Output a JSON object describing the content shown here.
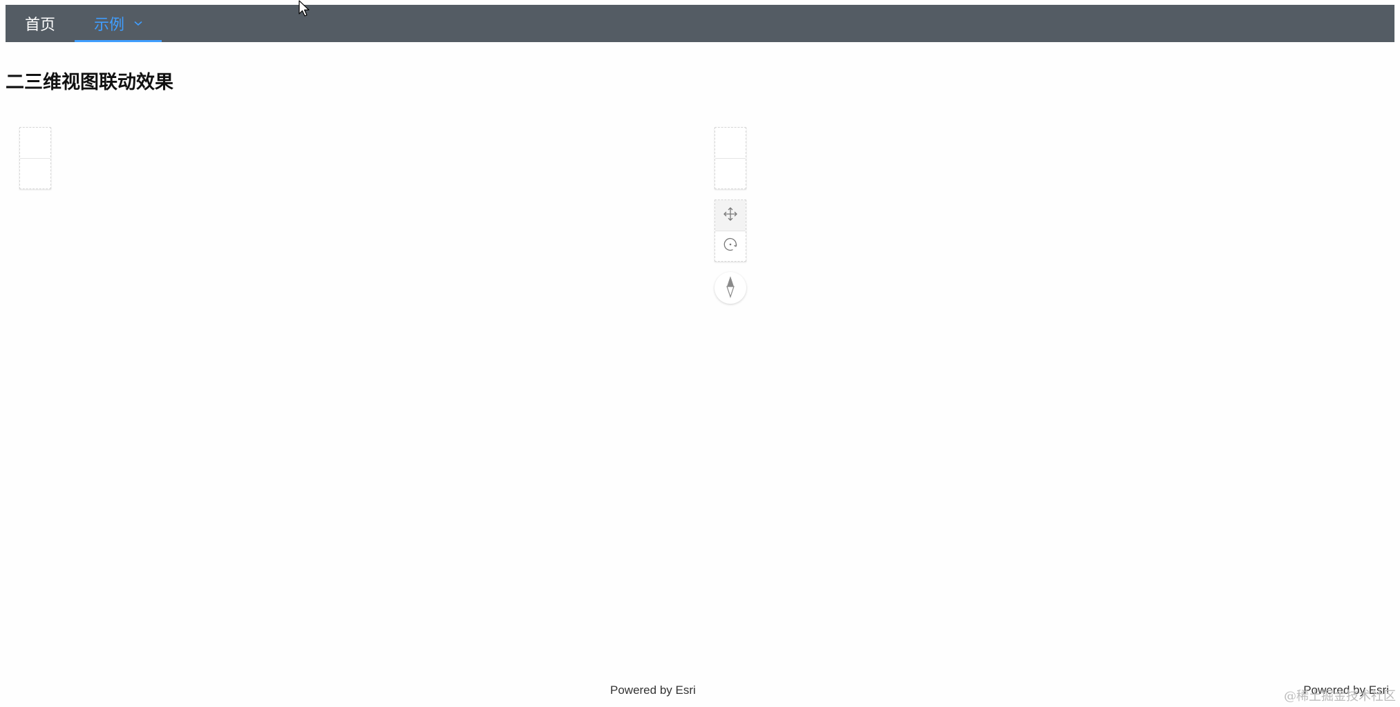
{
  "nav": {
    "items": [
      {
        "label": "首页",
        "active": false
      },
      {
        "label": "示例",
        "active": true,
        "has_dropdown": true
      }
    ],
    "background": "#545c64",
    "active_color": "#409eff"
  },
  "page": {
    "title": "二三维视图联动效果"
  },
  "views": {
    "left": {
      "attribution": "Powered by Esri",
      "icons": [
        "zoom-in-icon",
        "zoom-out-icon"
      ]
    },
    "right": {
      "attribution": "Powered by Esri",
      "icons": [
        "zoom-in-icon",
        "zoom-out-icon",
        "pan-icon",
        "rotate-icon",
        "compass-icon"
      ]
    }
  },
  "watermark": "@稀土掘金技术社区"
}
